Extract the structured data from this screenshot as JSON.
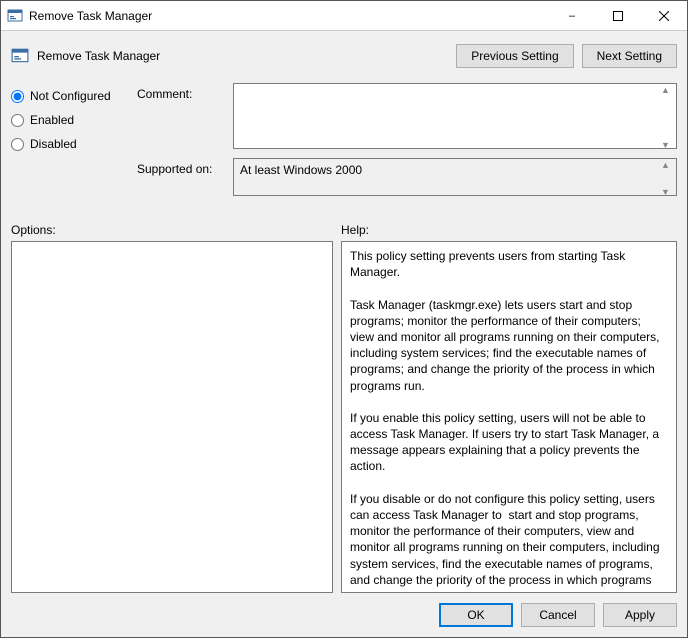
{
  "window": {
    "title": "Remove Task Manager"
  },
  "header": {
    "label": "Remove Task Manager",
    "previous": "Previous Setting",
    "next": "Next Setting"
  },
  "radios": {
    "not_configured": "Not Configured",
    "enabled": "Enabled",
    "disabled": "Disabled",
    "selected": "not_configured"
  },
  "fields": {
    "comment_label": "Comment:",
    "comment_value": "",
    "supported_label": "Supported on:",
    "supported_value": "At least Windows 2000"
  },
  "sections": {
    "options_label": "Options:",
    "help_label": "Help:"
  },
  "help_text": "This policy setting prevents users from starting Task Manager.\n\nTask Manager (taskmgr.exe) lets users start and stop programs; monitor the performance of their computers; view and monitor all programs running on their computers, including system services; find the executable names of programs; and change the priority of the process in which programs run.\n\nIf you enable this policy setting, users will not be able to access Task Manager. If users try to start Task Manager, a message appears explaining that a policy prevents the action.\n\nIf you disable or do not configure this policy setting, users can access Task Manager to  start and stop programs, monitor the performance of their computers, view and monitor all programs running on their computers, including system services, find the executable names of programs, and change the priority of the process in which programs run.",
  "footer": {
    "ok": "OK",
    "cancel": "Cancel",
    "apply": "Apply"
  }
}
